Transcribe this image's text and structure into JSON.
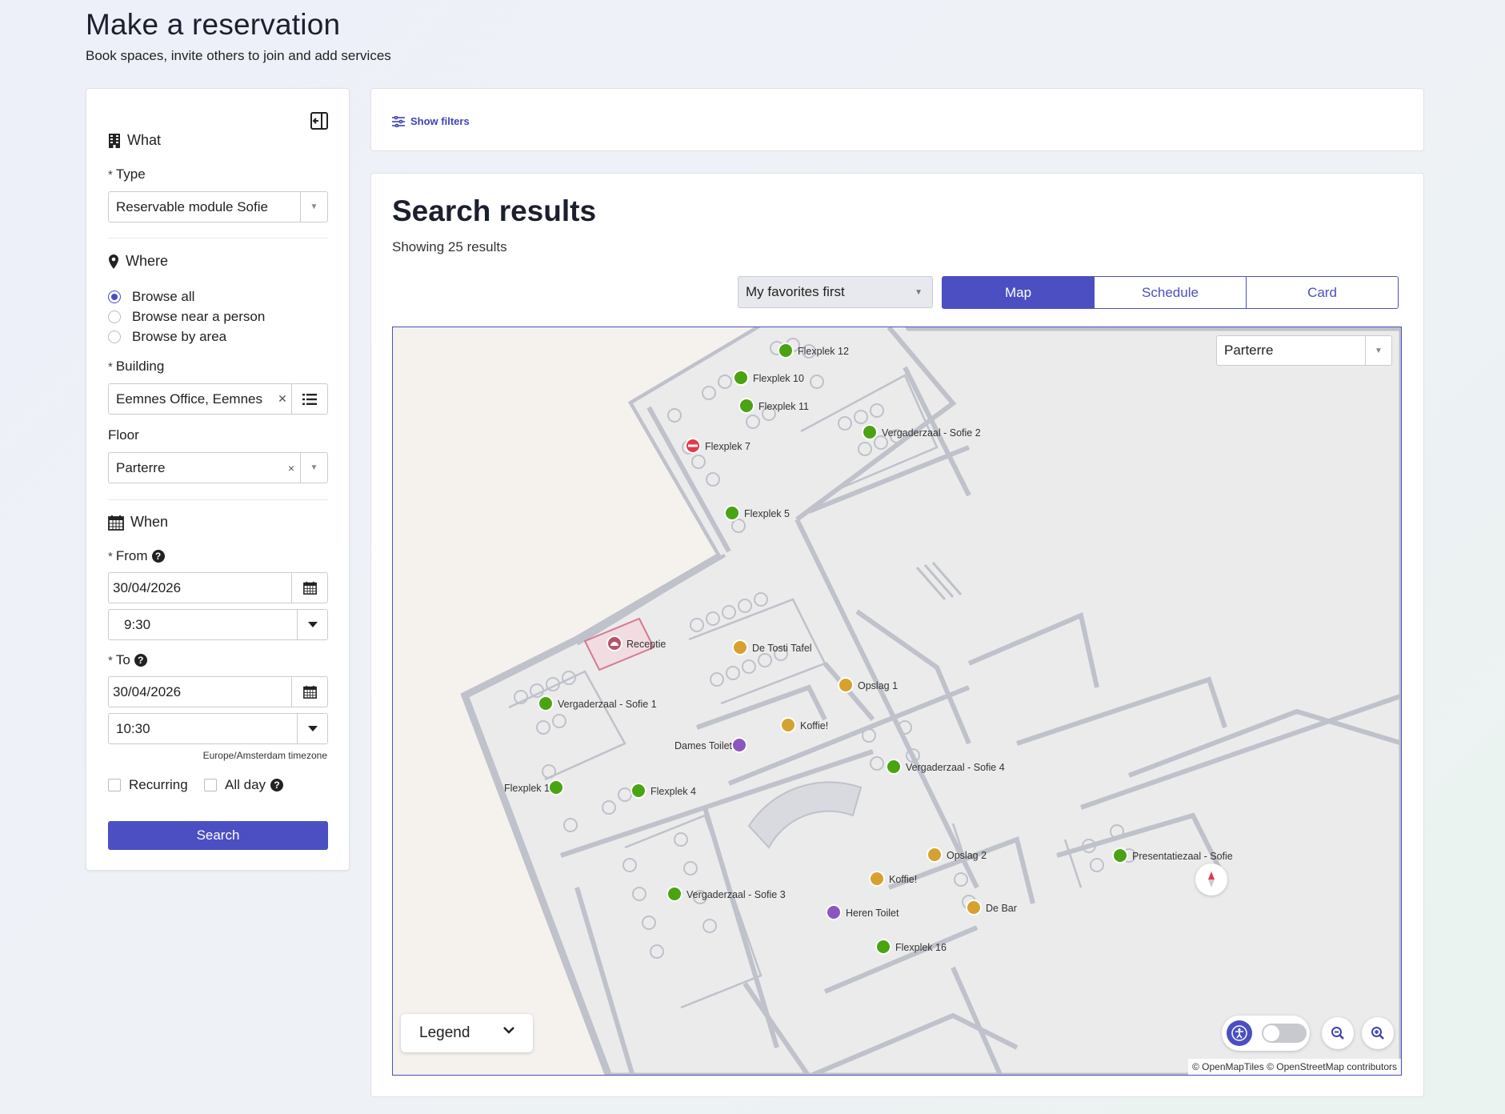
{
  "page": {
    "title": "Make a reservation",
    "subtitle": "Book spaces, invite others to join and add services"
  },
  "form": {
    "what_label": "What",
    "type_label": "Type",
    "type_value": "Reservable module Sofie",
    "where_label": "Where",
    "browse_options": [
      "Browse all",
      "Browse near a person",
      "Browse by area"
    ],
    "browse_selected": "Browse all",
    "building_label": "Building",
    "building_value": "Eemnes Office, Eemnes",
    "floor_label": "Floor",
    "floor_value": "Parterre",
    "when_label": "When",
    "from_label": "From",
    "from_date": "30/04/2026",
    "from_time": "9:30",
    "to_label": "To",
    "to_date": "30/04/2026",
    "to_time": "10:30",
    "timezone": "Europe/Amsterdam timezone",
    "recurring_label": "Recurring",
    "allday_label": "All day",
    "search_button": "Search",
    "required_marker": "*",
    "help_glyph": "?"
  },
  "filters": {
    "show_filters": "Show filters"
  },
  "results": {
    "title": "Search results",
    "count_text": "Showing 25 results",
    "sort_value": "My favorites first",
    "view_tabs": [
      "Map",
      "Schedule",
      "Card"
    ],
    "active_view": "Map"
  },
  "map": {
    "floor_value": "Parterre",
    "legend_label": "Legend",
    "attribution": "© OpenMapTiles © OpenStreetMap contributors",
    "accessibility_toggle": false,
    "colors": {
      "available": "#4aa312",
      "unavailable": "#e23a4a",
      "service": "#d7a12f",
      "toilet": "#8c55c0",
      "reception": "#b35468",
      "wall": "#bfc1cb"
    },
    "pois": [
      {
        "label": "Flexplek 12",
        "kind": "available"
      },
      {
        "label": "Flexplek 10",
        "kind": "available"
      },
      {
        "label": "Flexplek 11",
        "kind": "available"
      },
      {
        "label": "Vergaderzaal - Sofie 2",
        "kind": "available"
      },
      {
        "label": "Flexplek 7",
        "kind": "unavailable"
      },
      {
        "label": "Flexplek 5",
        "kind": "available"
      },
      {
        "label": "Receptie",
        "kind": "reception"
      },
      {
        "label": "De Tosti Tafel",
        "kind": "service"
      },
      {
        "label": "Opslag 1",
        "kind": "service"
      },
      {
        "label": "Vergaderzaal - Sofie 1",
        "kind": "available"
      },
      {
        "label": "Koffie!",
        "kind": "service"
      },
      {
        "label": "Dames Toilet",
        "kind": "toilet"
      },
      {
        "label": "Vergaderzaal - Sofie 4",
        "kind": "available"
      },
      {
        "label": "Flexplek 1",
        "kind": "available"
      },
      {
        "label": "Flexplek 4",
        "kind": "available"
      },
      {
        "label": "Opslag 2",
        "kind": "service"
      },
      {
        "label": "Presentatiezaal - Sofie",
        "kind": "available"
      },
      {
        "label": "Koffie!",
        "kind": "service"
      },
      {
        "label": "Vergaderzaal - Sofie 3",
        "kind": "available"
      },
      {
        "label": "Heren Toilet",
        "kind": "toilet"
      },
      {
        "label": "De Bar",
        "kind": "service"
      },
      {
        "label": "Flexplek 16",
        "kind": "available"
      }
    ]
  }
}
